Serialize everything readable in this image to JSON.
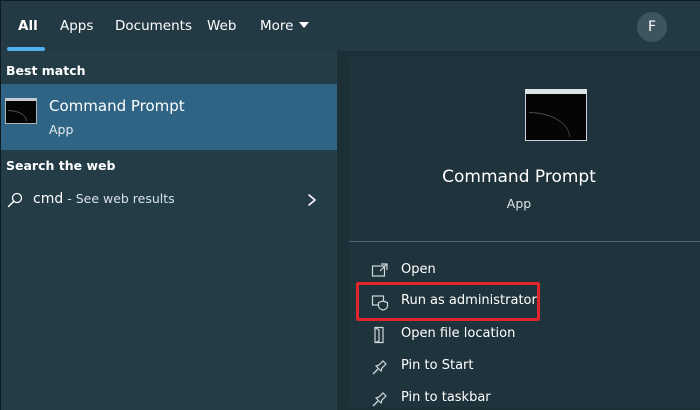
{
  "tabs": [
    {
      "label": "All",
      "active": true
    },
    {
      "label": "Apps"
    },
    {
      "label": "Documents"
    },
    {
      "label": "Web"
    },
    {
      "label": "More"
    }
  ],
  "user": {
    "avatar_initial": "F"
  },
  "left": {
    "best_match_heading": "Best match",
    "best_match": {
      "title": "Command Prompt",
      "subtitle": "App",
      "icon": "command-prompt-icon"
    },
    "search_web_heading": "Search the web",
    "web_result": {
      "query": "cmd",
      "suffix": " - See web results",
      "icon": "search-icon"
    }
  },
  "detail": {
    "title": "Command Prompt",
    "subtitle": "App",
    "actions": [
      {
        "label": "Open",
        "icon": "open-icon"
      },
      {
        "label": "Run as administrator",
        "icon": "shield-icon",
        "highlighted": true
      },
      {
        "label": "Open file location",
        "icon": "file-location-icon"
      },
      {
        "label": "Pin to Start",
        "icon": "pin-icon"
      },
      {
        "label": "Pin to taskbar",
        "icon": "pin-icon"
      }
    ]
  },
  "colors": {
    "accent": "#4fb0f0",
    "selected_row": "#2f6484",
    "highlight": "#e0262c"
  }
}
